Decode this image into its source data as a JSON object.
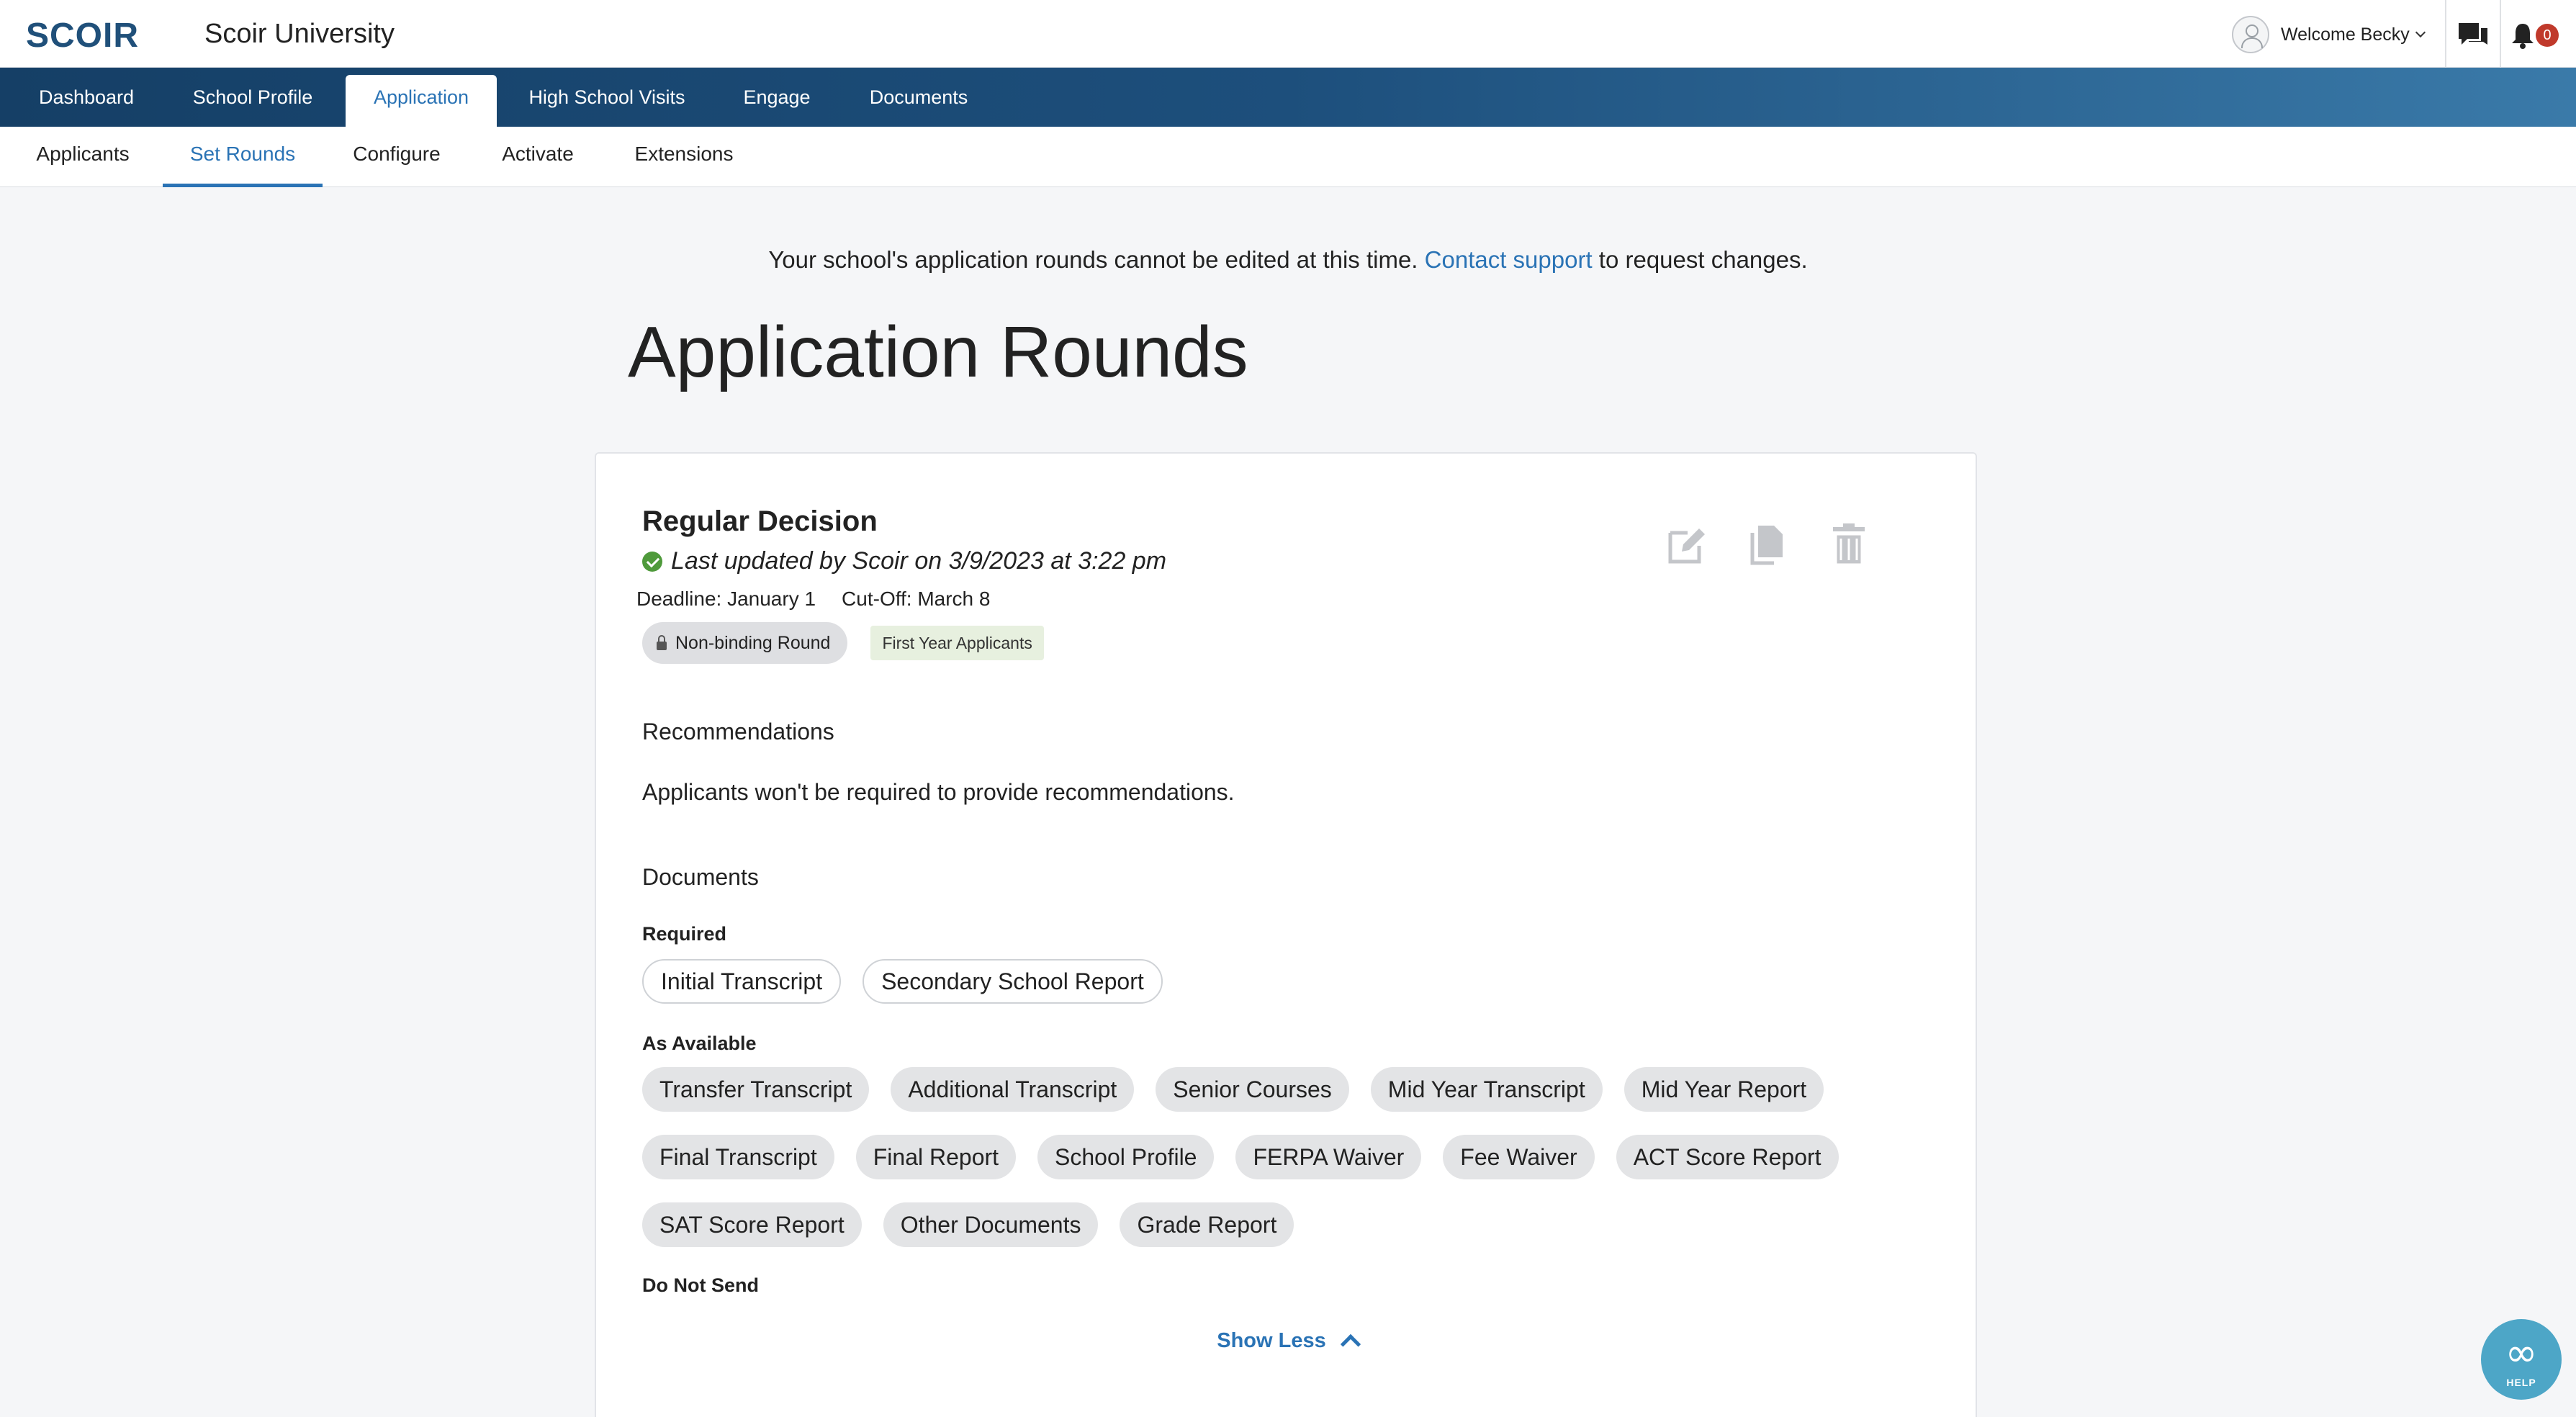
{
  "header": {
    "logo": "SCOIR",
    "university": "Scoir University",
    "welcome": "Welcome Becky",
    "notification_count": "0"
  },
  "main_nav": {
    "tabs": [
      {
        "label": "Dashboard",
        "active": false
      },
      {
        "label": "School Profile",
        "active": false
      },
      {
        "label": "Application",
        "active": true
      },
      {
        "label": "High School Visits",
        "active": false
      },
      {
        "label": "Engage",
        "active": false
      },
      {
        "label": "Documents",
        "active": false
      }
    ]
  },
  "sub_nav": {
    "tabs": [
      {
        "label": "Applicants",
        "active": false
      },
      {
        "label": "Set Rounds",
        "active": true
      },
      {
        "label": "Configure",
        "active": false
      },
      {
        "label": "Activate",
        "active": false
      },
      {
        "label": "Extensions",
        "active": false
      }
    ]
  },
  "notice": {
    "before": "Your school's application rounds cannot be edited at this time.",
    "link": "Contact support",
    "after": "to request changes."
  },
  "page_title": "Application Rounds",
  "round": {
    "name": "Regular Decision",
    "updated": "Last updated by Scoir on 3/9/2023 at 3:22 pm",
    "deadline": "Deadline: January 1",
    "cutoff": "Cut-Off: March 8",
    "binding_tag": "Non-binding Round",
    "applicant_tag": "First Year Applicants",
    "recommendations_heading": "Recommendations",
    "recommendations_text": "Applicants won't be required to provide recommendations.",
    "documents_heading": "Documents",
    "required_label": "Required",
    "required_docs": [
      "Initial Transcript",
      "Secondary School Report"
    ],
    "as_available_label": "As Available",
    "as_available_docs": [
      [
        "Transfer Transcript",
        "Additional Transcript",
        "Senior Courses",
        "Mid Year Transcript",
        "Mid Year Report"
      ],
      [
        "Final Transcript",
        "Final Report",
        "School Profile",
        "FERPA Waiver",
        "Fee Waiver",
        "ACT Score Report"
      ],
      [
        "SAT Score Report",
        "Other Documents",
        "Grade Report"
      ]
    ],
    "do_not_send_label": "Do Not Send",
    "show_less": "Show Less"
  },
  "help": {
    "label": "HELP"
  },
  "colors": {
    "accent": "#2a73b5",
    "nav_dark": "#153f66",
    "success": "#4f9a3b",
    "badge": "#c0392b"
  }
}
